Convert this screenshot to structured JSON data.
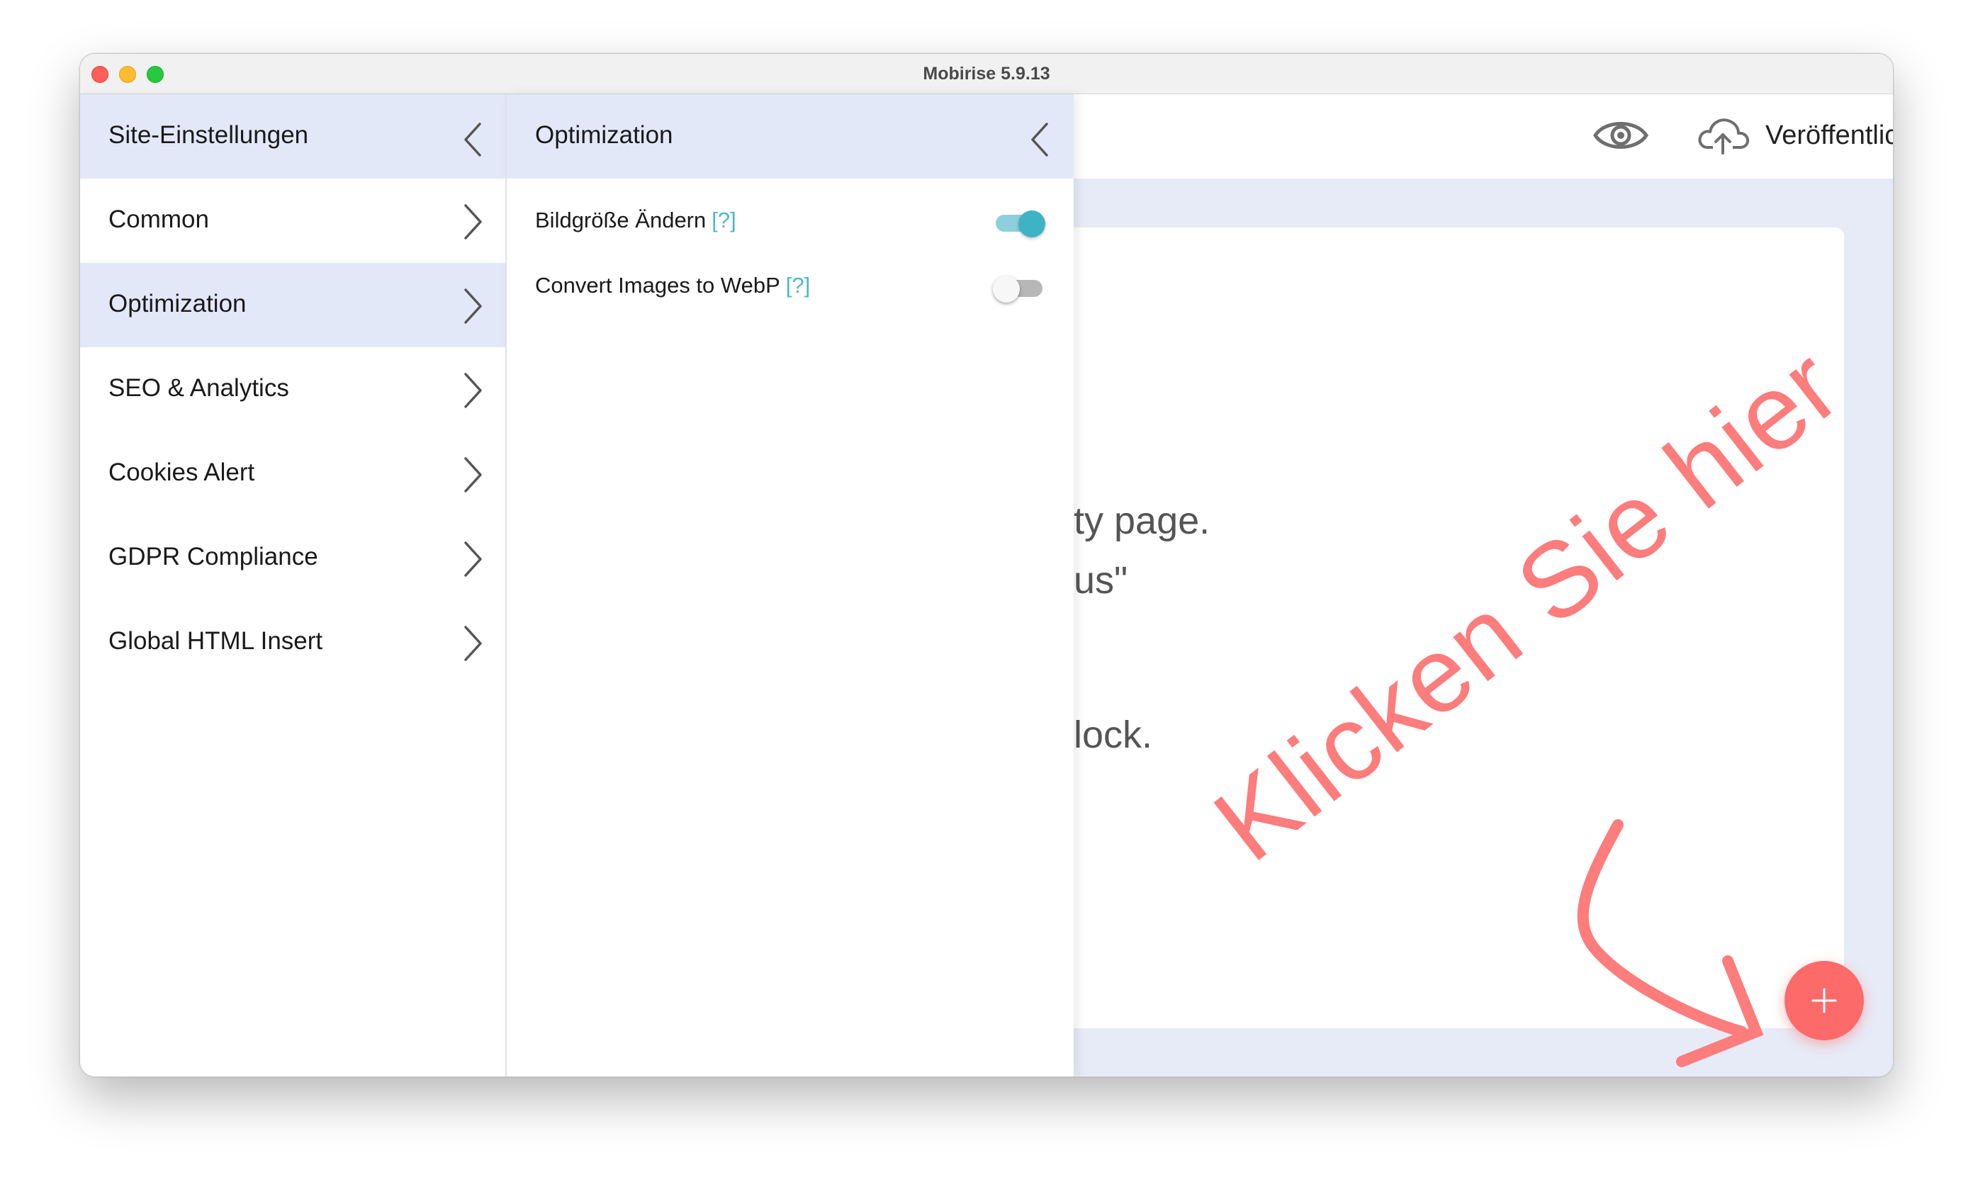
{
  "window": {
    "title": "Mobirise 5.9.13"
  },
  "topbar": {
    "publish_label": "Veröffentlichen"
  },
  "canvas": {
    "line1": "ty page.",
    "line2": "us\"",
    "line3": "lock.",
    "hint": "Klicken Sie hier"
  },
  "settings": {
    "title": "Site-Einstellungen",
    "items": [
      {
        "label": "Common"
      },
      {
        "label": "Optimization",
        "active": true
      },
      {
        "label": "SEO & Analytics"
      },
      {
        "label": "Cookies Alert"
      },
      {
        "label": "GDPR Compliance"
      },
      {
        "label": "Global HTML Insert"
      }
    ]
  },
  "optimization": {
    "title": "Optimization",
    "options": [
      {
        "label": "Bildgröße Ändern",
        "help": "[?]",
        "enabled": true
      },
      {
        "label": "Convert Images to WebP",
        "help": "[?]",
        "enabled": false
      }
    ]
  },
  "colors": {
    "accent": "#3fb3c6",
    "header_bg": "#e3e8f9",
    "fab": "#fd6a6a",
    "hint": "#fd7c7c"
  },
  "icons": {
    "preview": "eye-icon",
    "publish": "cloud-upload-icon",
    "back": "chevron-left-icon",
    "forward": "chevron-right-icon",
    "add": "plus-icon"
  }
}
